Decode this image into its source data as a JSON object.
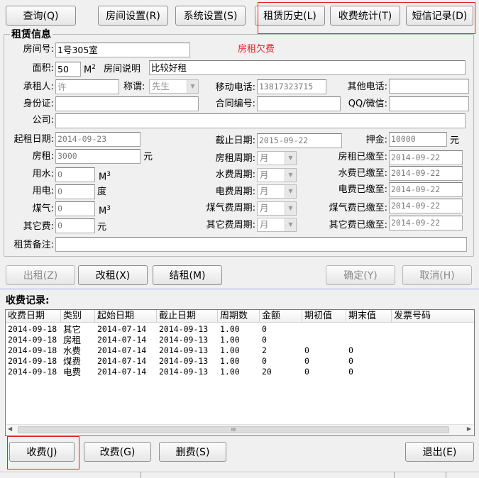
{
  "toolbar": {
    "query": "查询(Q)",
    "room_settings": "房间设置(R)",
    "system_settings": "系统设置(S)",
    "rent_history": "租赁历史(L)",
    "fee_stats": "收费统计(T)",
    "sms_records": "短信记录(D)"
  },
  "lease_info": {
    "group_title": "租赁信息",
    "room_no_label": "房间号:",
    "room_no": "1号305室",
    "alert": "房租欠费",
    "area_label": "面积:",
    "area": "50",
    "area_unit": "M",
    "area_unit_sup": "2",
    "room_desc_label": "房间说明",
    "room_desc": "比较好租",
    "tenant_label": "承租人:",
    "tenant": "许",
    "title_label": "称谓:",
    "title_value": "先生",
    "mobile_label": "移动电话:",
    "mobile": "13817323715",
    "other_phone_label": "其他电话:",
    "other_phone": "",
    "id_label": "身份证:",
    "id_value": "",
    "contract_label": "合同编号:",
    "contract": "",
    "qq_label": "QQ/微信:",
    "qq": "",
    "company_label": "公司:",
    "company": "",
    "start_label": "起租日期:",
    "start_date": "2014-09-23",
    "end_label": "截止日期:",
    "end_date": "2015-09-22",
    "deposit_label": "押金:",
    "deposit": "10000",
    "yuan": "元",
    "rent_label": "房租:",
    "rent": "3000",
    "rent_cycle_label": "房租周期:",
    "rent_cycle": "月",
    "rent_paid_label": "房租已缴至:",
    "rent_paid": "2014-09-22",
    "water_label": "用水:",
    "water": "0",
    "water_unit": "M",
    "water_unit_sup": "3",
    "water_cycle_label": "水费周期:",
    "water_cycle": "月",
    "water_paid_label": "水费已缴至:",
    "water_paid": "2014-09-22",
    "power_label": "用电:",
    "power": "0",
    "power_unit": "度",
    "power_cycle_label": "电费周期:",
    "power_cycle": "月",
    "power_paid_label": "电费已缴至:",
    "power_paid": "2014-09-22",
    "gas_label": "煤气:",
    "gas": "0",
    "gas_unit": "M",
    "gas_unit_sup": "3",
    "gas_cycle_label": "煤气费周期:",
    "gas_cycle": "月",
    "gas_paid_label": "煤气费已缴至:",
    "gas_paid": "2014-09-22",
    "other_label": "其它费:",
    "other": "0",
    "other_cycle_label": "其它费周期:",
    "other_cycle": "月",
    "other_paid_label": "其它费已缴至:",
    "other_paid": "2014-09-22",
    "remark_label": "租赁备注:",
    "remark": ""
  },
  "actions": {
    "move_out": "出租(Z)",
    "change_rent": "改租(X)",
    "settle": "结租(M)",
    "confirm": "确定(Y)",
    "cancel": "取消(H)"
  },
  "records": {
    "title": "收费记录:",
    "columns": [
      "收费日期",
      "类别",
      "起始日期",
      "截止日期",
      "周期数",
      "金额",
      "期初值",
      "期末值",
      "发票号码"
    ],
    "rows": [
      [
        "2014-09-18",
        "其它",
        "2014-07-14",
        "2014-09-13",
        "1.00",
        "0",
        "",
        ""
      ],
      [
        "2014-09-18",
        "房租",
        "2014-07-14",
        "2014-09-13",
        "1.00",
        "0",
        "",
        ""
      ],
      [
        "2014-09-18",
        "水费",
        "2014-07-14",
        "2014-09-13",
        "1.00",
        "2",
        "0",
        "0"
      ],
      [
        "2014-09-18",
        "煤费",
        "2014-07-14",
        "2014-09-13",
        "1.00",
        "0",
        "0",
        "0"
      ],
      [
        "2014-09-18",
        "电费",
        "2014-07-14",
        "2014-09-13",
        "1.00",
        "20",
        "0",
        "0"
      ]
    ],
    "scroll_thumb": "III"
  },
  "bottom": {
    "charge": "收费(J)",
    "edit_fee": "改费(G)",
    "delete_fee": "删费(S)",
    "exit": "退出(E)"
  },
  "colors": {
    "alert": "#e0222a",
    "highlight_box": "#e0222a"
  }
}
